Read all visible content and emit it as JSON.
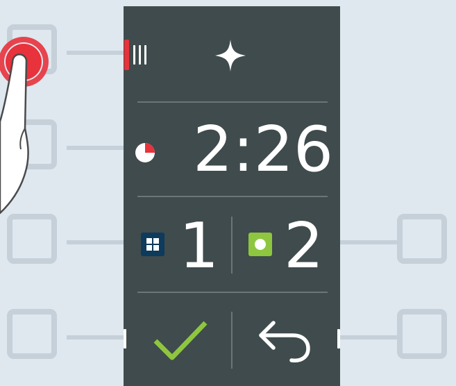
{
  "colors": {
    "background": "#dfe7ef",
    "panel": "#3f4b4c",
    "hardware_key": "#c5d0d8",
    "indicator_red": "#e8323c",
    "check_green": "#8ec63f",
    "tray_blue": "#0e3a5c",
    "divider": "#6b7676",
    "text": "#ffffff"
  },
  "display": {
    "level_indicator": {
      "active_marks": 1,
      "total_marks": 4
    },
    "header_icon": "sparkle-icon",
    "timer": {
      "icon": "timer-pie-icon",
      "elapsed_fraction": 0.25,
      "value": "2:26"
    },
    "selection_left": {
      "icon": "grid-tray-icon",
      "value": "1"
    },
    "selection_right": {
      "icon": "single-tray-icon",
      "value": "2"
    },
    "confirm_icon": "checkmark-icon",
    "back_icon": "back-arrow-icon"
  },
  "hand": {
    "icon": "pointing-hand-icon",
    "press_indicator": "press-ripple-icon"
  }
}
